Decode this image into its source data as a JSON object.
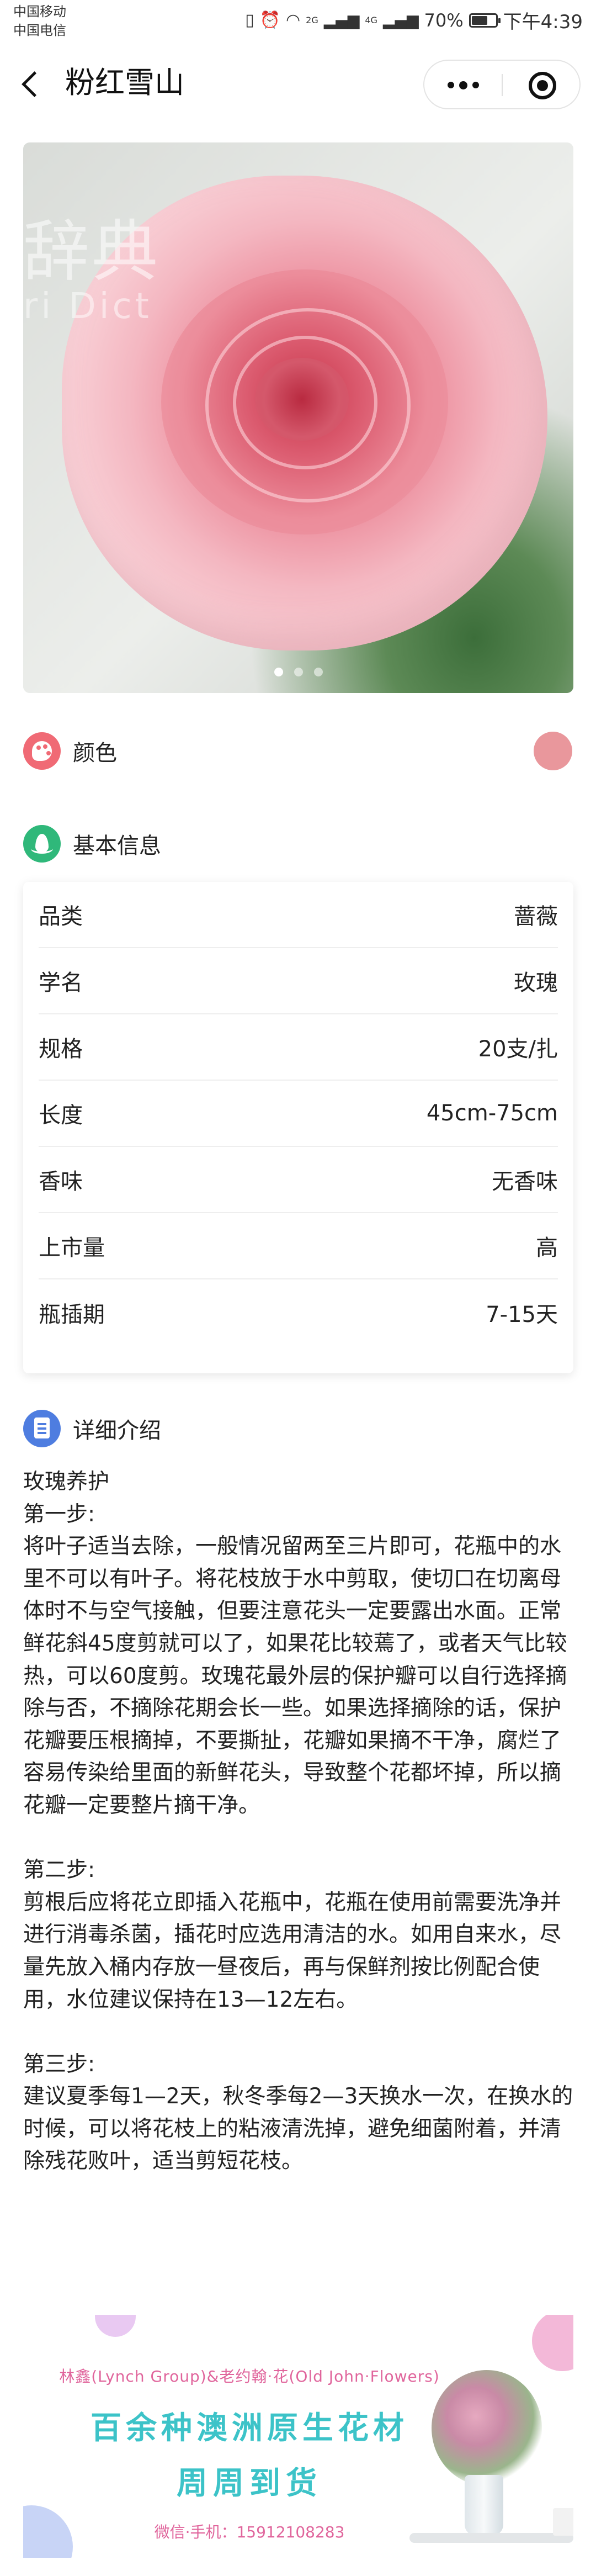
{
  "status_bar": {
    "carrier_1": "中国移动",
    "carrier_2": "中国电信",
    "icons": [
      "vibrate-icon",
      "alarm-icon",
      "wifi-icon",
      "signal-icon",
      "signal-icon"
    ],
    "net_1": "2G",
    "net_2": "4G",
    "battery": "70%",
    "battery_level": 0.7,
    "time": "下午4:39"
  },
  "nav": {
    "title": "粉红雪山"
  },
  "hero": {
    "watermark_line1": "辞典",
    "watermark_line2": "ri Dict",
    "slide_count": 3,
    "active_slide": 1
  },
  "color_section": {
    "label": "颜色",
    "swatch_color": "#e9979c"
  },
  "basic_info": {
    "label": "基本信息",
    "rows": [
      {
        "key": "品类",
        "value": "蔷薇"
      },
      {
        "key": "学名",
        "value": "玫瑰"
      },
      {
        "key": "规格",
        "value": "20支/扎"
      },
      {
        "key": "长度",
        "value": "45cm-75cm"
      },
      {
        "key": "香味",
        "value": "无香味"
      },
      {
        "key": "上市量",
        "value": "高"
      },
      {
        "key": "瓶插期",
        "value": "7-15天"
      }
    ]
  },
  "detail": {
    "label": "详细介绍",
    "title": "玫瑰养护",
    "step1_title": "第一步:",
    "step1_text": "将叶子适当去除，一般情况留两至三片即可，花瓶中的水里不可以有叶子。将花枝放于水中剪取，使切口在切离母体时不与空气接触，但要注意花头一定要露出水面。正常鲜花斜45度剪就可以了，如果花比较蔫了，或者天气比较热，可以60度剪。玫瑰花最外层的保护瓣可以自行选择摘除与否，不摘除花期会长一些。如果选择摘除的话，保护花瓣要压根摘掉，不要撕扯，花瓣如果摘不干净，腐烂了容易传染给里面的新鲜花头，导致整个花都坏掉，所以摘花瓣一定要整片摘干净。",
    "step2_title": "第二步:",
    "step2_text": "剪根后应将花立即插入花瓶中，花瓶在使用前需要洗净并进行消毒杀菌，插花时应选用清洁的水。如用自来水，尽量先放入桶内存放一昼夜后，再与保鲜剂按比例配合使用，水位建议保持在13—12左右。",
    "step3_title": "第三步:",
    "step3_text": "建议夏季每1—2天，秋冬季每2—3天换水一次，在换水的时候，可以将花枝上的粘液清洗掉，避免细菌附着，并清除残花败叶，适当剪短花枝。"
  },
  "banner": {
    "line1": "林鑫(Lynch Group)&老约翰·花(Old John·Flowers)",
    "line2": "百余种澳洲原生花材",
    "line3": "周周到货",
    "line4": "微信·手机：15912108283"
  }
}
